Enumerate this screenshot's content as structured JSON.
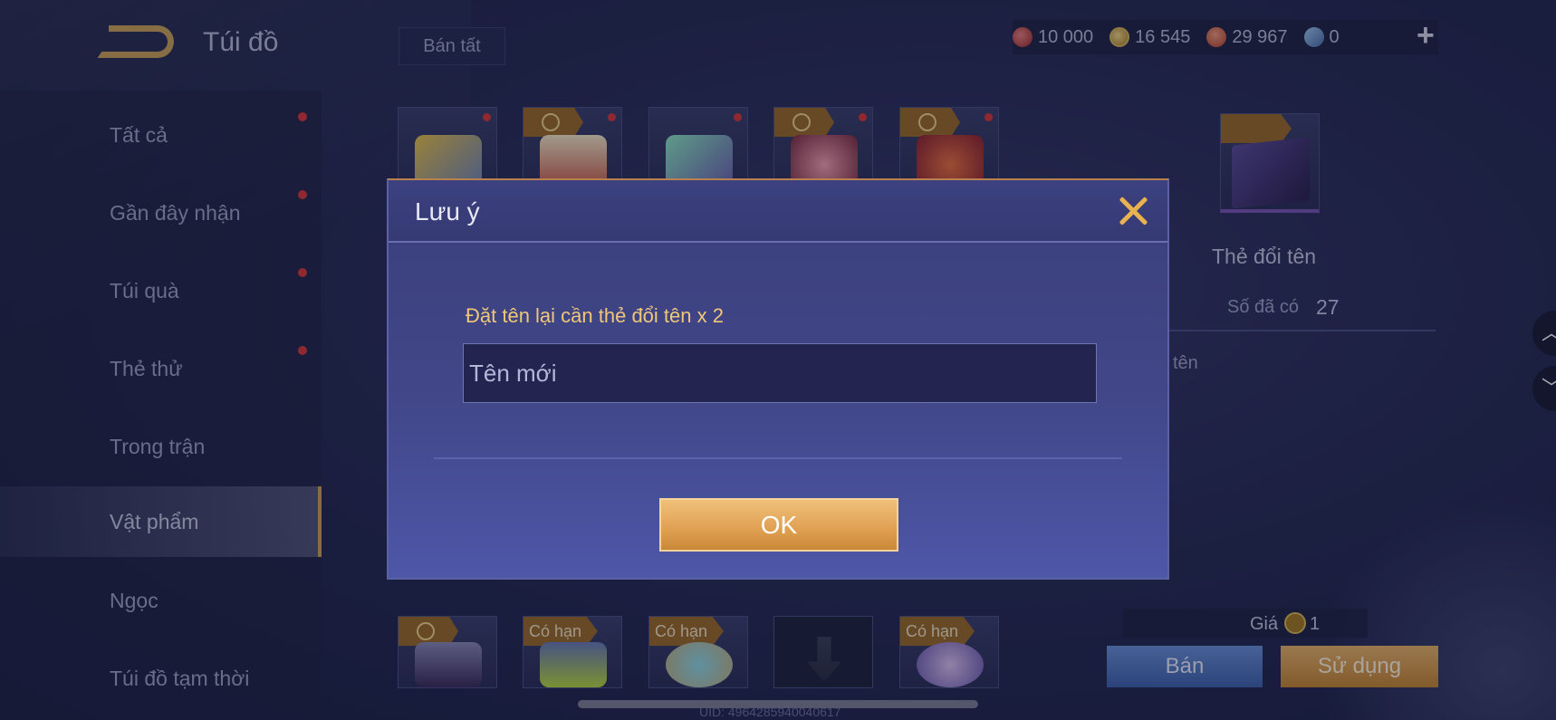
{
  "header": {
    "title": "Túi đồ",
    "sell_all_label": "Bán tất",
    "currencies": [
      {
        "icon": "ruby-icon",
        "value": "10 000"
      },
      {
        "icon": "gold-coin-icon",
        "value": "16 545"
      },
      {
        "icon": "gem-icon",
        "value": "29 967"
      },
      {
        "icon": "card-icon",
        "value": "0"
      }
    ],
    "plus_label": "+"
  },
  "sidebar": {
    "items": [
      {
        "label": "Tất cả",
        "dot": true
      },
      {
        "label": "Gần đây nhận",
        "dot": true
      },
      {
        "label": "Túi quà",
        "dot": true
      },
      {
        "label": "Thẻ thử",
        "dot": true
      },
      {
        "label": "Trong trận",
        "dot": false
      },
      {
        "label": "Vật phẩm",
        "dot": false,
        "active": true
      },
      {
        "label": "Ngọc",
        "dot": false
      },
      {
        "label": "Túi đồ tạm thời",
        "dot": false
      }
    ]
  },
  "grid": {
    "bottom_row_badges": [
      "",
      "Có hạn",
      "Có hạn",
      "",
      "Có hạn"
    ]
  },
  "detail": {
    "name": "Thẻ đổi tên",
    "owned_label": "Số đã có",
    "owned_value": "27",
    "desc_partial": "tên",
    "price_label": "Giá",
    "price_value": "1",
    "sell_label": "Bán",
    "use_label": "Sử dụng"
  },
  "modal": {
    "title": "Lưu ý",
    "message": "Đặt tên lại cần thẻ đổi tên x 2",
    "input_placeholder": "Tên mới",
    "input_value": "",
    "ok_label": "OK"
  },
  "footer": {
    "uid": "UID: 49642859400406​17"
  },
  "colors": {
    "accent_gold": "#e0a052",
    "notify_red": "#d83a3a",
    "modal_bg": "#414789"
  }
}
